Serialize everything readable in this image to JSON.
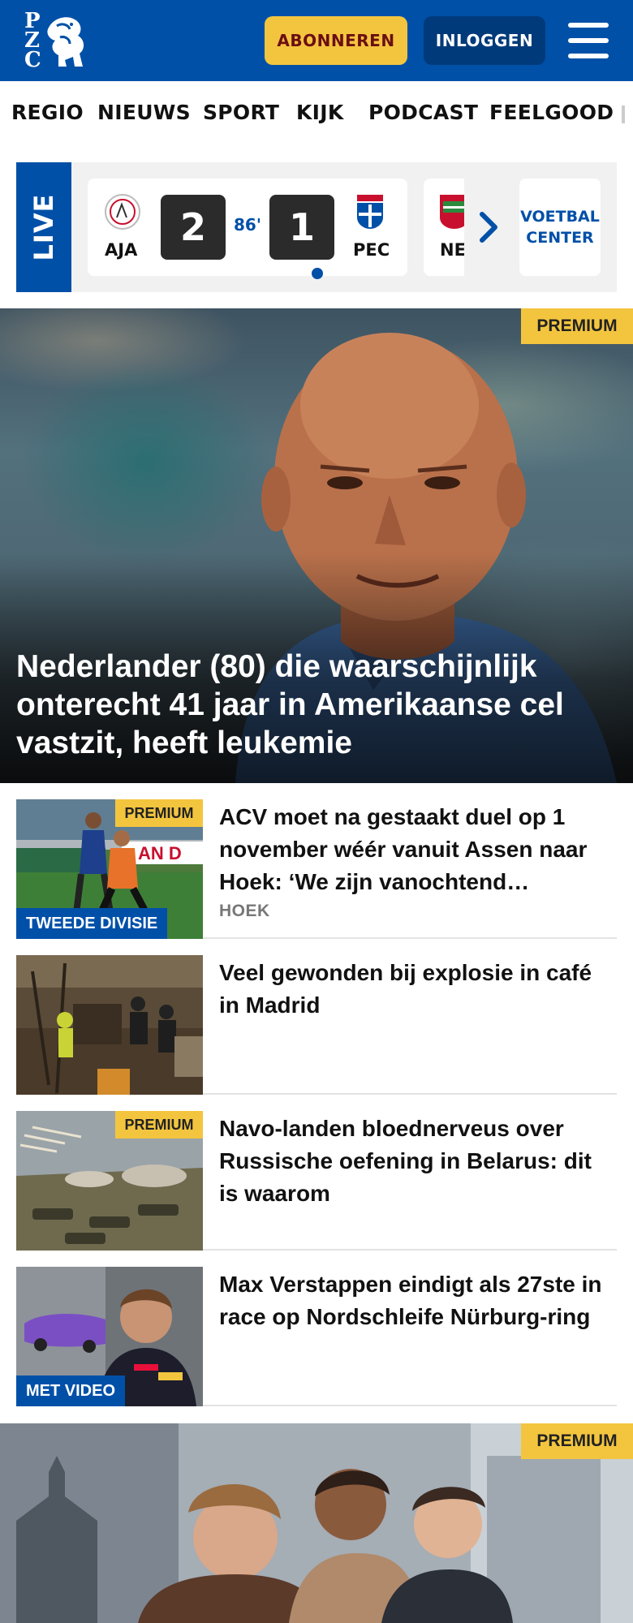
{
  "header": {
    "logo_letters": "P Z C",
    "subscribe_label": "ABONNEREN",
    "login_label": "INLOGGEN"
  },
  "nav": {
    "items": [
      "REGIO",
      "NIEUWS",
      "SPORT",
      "KIJK",
      "PODCAST",
      "FEELGOOD"
    ]
  },
  "live": {
    "label": "LIVE",
    "match": {
      "home_team": "AJA",
      "home_score": "2",
      "minute": "86'",
      "away_score": "1",
      "away_team": "PEC"
    },
    "next_match_team": "NE",
    "voetbal_center_line1": "VOETBAL",
    "voetbal_center_line2": "CENTER"
  },
  "hero": {
    "premium_label": "PREMIUM",
    "title": "Nederlander (80) die waarschijnlijk onterecht 41 jaar in Amerikaanse cel vastzit, heeft leukemie"
  },
  "articles": [
    {
      "title": "ACV moet na gestaakt duel op 1 november wéér vanuit Assen naar Hoek: ‘We zijn vanochtend…",
      "subtitle": "HOEK",
      "premium_label": "PREMIUM",
      "tag": "TWEEDE DIVISIE"
    },
    {
      "title": "Veel gewonden bij explosie in café in Madrid"
    },
    {
      "title": "Navo-landen bloednerveus over Russische oefening in Belarus: dit is waarom",
      "premium_label": "PREMIUM"
    },
    {
      "title": "Max Verstappen eindigt als 27ste in race op Nordschleife Nürburg-ring",
      "tag": "MET VIDEO"
    }
  ],
  "hero2": {
    "premium_label": "PREMIUM"
  },
  "colors": {
    "brand_blue": "#0050a8",
    "dark_blue": "#003a7a",
    "premium_yellow": "#f3c53f",
    "subscribe_text": "#6b0f12"
  }
}
